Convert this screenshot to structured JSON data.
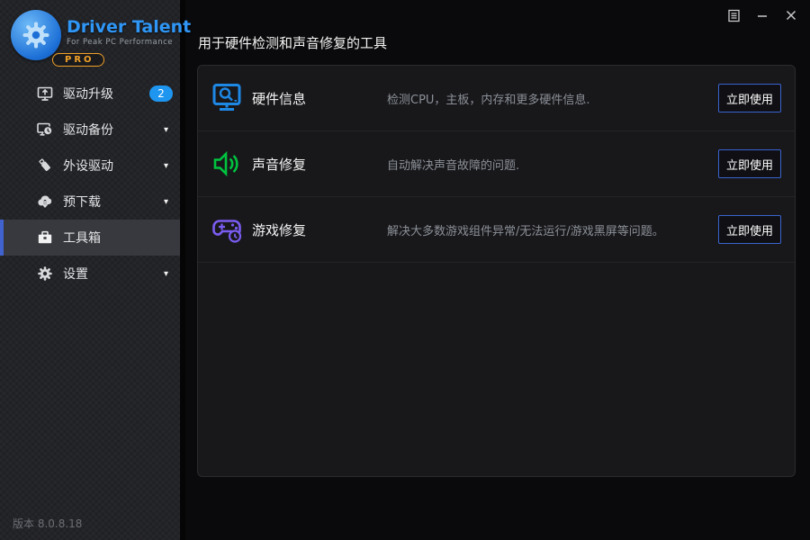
{
  "logo": {
    "title": "Driver Talent",
    "subtitle": "For Peak PC Performance",
    "badge": "PRO"
  },
  "sidebar": {
    "items": [
      {
        "label": "驱动升级",
        "icon": "monitor-upload-icon",
        "badge": "2"
      },
      {
        "label": "驱动备份",
        "icon": "monitor-clock-icon",
        "caret": "▾"
      },
      {
        "label": "外设驱动",
        "icon": "usb-drive-icon",
        "caret": "▾"
      },
      {
        "label": "预下载",
        "icon": "cloud-download-icon",
        "caret": "▾"
      },
      {
        "label": "工具箱",
        "icon": "toolbox-icon",
        "active": true
      },
      {
        "label": "设置",
        "icon": "gear-icon",
        "caret": "▾"
      }
    ],
    "version": "版本 8.0.8.18"
  },
  "main": {
    "title": "用于硬件检测和声音修复的工具",
    "tools": [
      {
        "name": "硬件信息",
        "description": "检测CPU，主板，内存和更多硬件信息.",
        "icon": "monitor-search-icon",
        "icon_color": "#1e88e5",
        "button_label": "立即使用"
      },
      {
        "name": "声音修复",
        "description": "自动解决声音故障的问题.",
        "icon": "speaker-icon",
        "icon_color": "#00c33e",
        "button_label": "立即使用"
      },
      {
        "name": "游戏修复",
        "description": "解决大多数游戏组件异常/无法运行/游戏黑屏等问题。",
        "icon": "gamepad-clock-icon",
        "icon_color": "#7a5cf0",
        "button_label": "立即使用"
      }
    ]
  },
  "colors": {
    "accent_blue": "#1e96f0",
    "active_border": "#4063cf",
    "button_border": "#3a63cf",
    "pro_orange": "#f0a128",
    "tool_blue": "#1e88e5",
    "tool_green": "#00c33e",
    "tool_purple": "#7a5cf0"
  }
}
